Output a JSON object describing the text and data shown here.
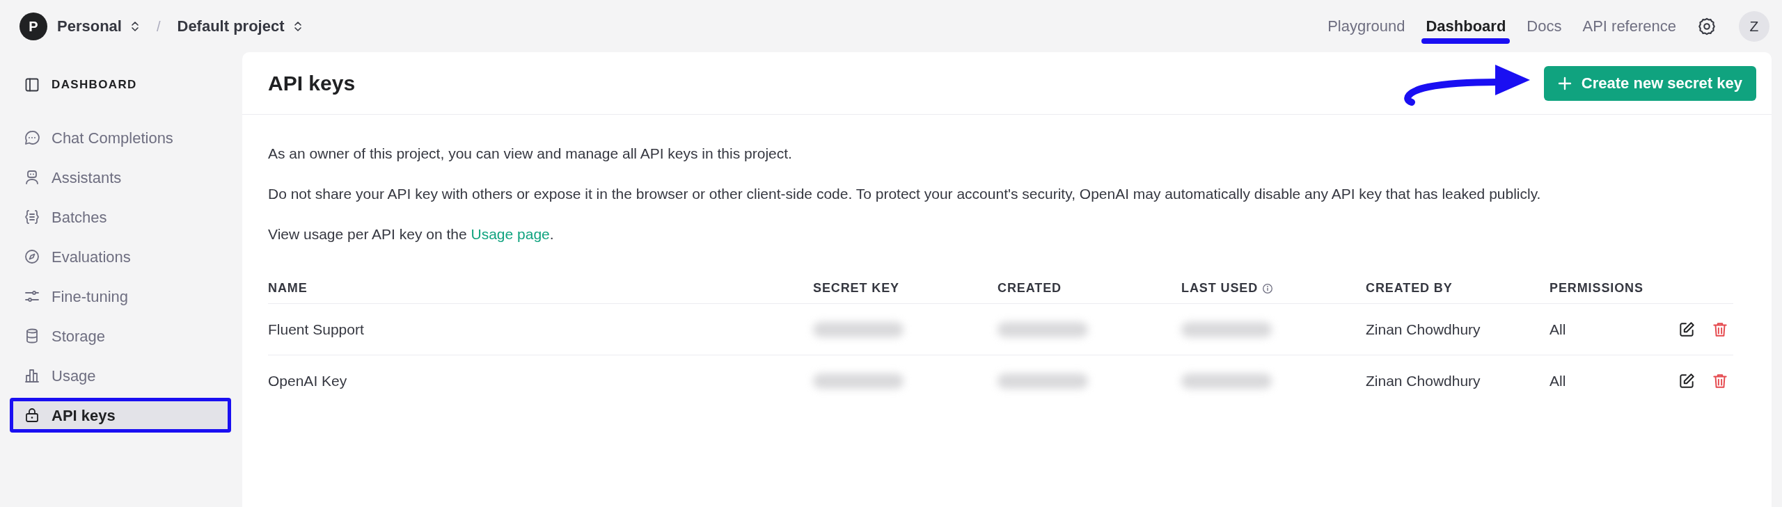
{
  "topbar": {
    "org": {
      "initial": "P",
      "name": "Personal"
    },
    "separator": "/",
    "project": "Default project",
    "nav": [
      {
        "label": "Playground",
        "selected": false,
        "highlighted": false
      },
      {
        "label": "Dashboard",
        "selected": true,
        "highlighted": true
      },
      {
        "label": "Docs",
        "selected": false,
        "highlighted": false
      },
      {
        "label": "API reference",
        "selected": false,
        "highlighted": false
      }
    ],
    "user_initial": "Z"
  },
  "sidebar": {
    "heading": "DASHBOARD",
    "items": [
      {
        "label": "Chat Completions",
        "kind": "chat",
        "selected": false,
        "highlighted": false
      },
      {
        "label": "Assistants",
        "kind": "bot",
        "selected": false,
        "highlighted": false
      },
      {
        "label": "Batches",
        "kind": "braces",
        "selected": false,
        "highlighted": false
      },
      {
        "label": "Evaluations",
        "kind": "compass",
        "selected": false,
        "highlighted": false
      },
      {
        "label": "Fine-tuning",
        "kind": "sliders",
        "selected": false,
        "highlighted": false
      },
      {
        "label": "Storage",
        "kind": "database",
        "selected": false,
        "highlighted": false
      },
      {
        "label": "Usage",
        "kind": "chart",
        "selected": false,
        "highlighted": false
      },
      {
        "label": "API keys",
        "kind": "lock",
        "selected": true,
        "highlighted": true
      }
    ]
  },
  "main": {
    "title": "API keys",
    "create_button": {
      "label": "Create new secret key",
      "callout_arrow": true
    },
    "paragraphs": [
      "As an owner of this project, you can view and manage all API keys in this project.",
      "Do not share your API key with others or expose it in the browser or other client-side code. To protect your account's security, OpenAI may automatically disable any API key that has leaked publicly."
    ],
    "usage_line": {
      "text": "View usage per API key on the",
      "link": "Usage page",
      "end": "."
    },
    "table": {
      "columns": [
        {
          "label": "NAME"
        },
        {
          "label": "SECRET KEY"
        },
        {
          "label": "CREATED"
        },
        {
          "label": "LAST USED",
          "info": true
        },
        {
          "label": "CREATED BY"
        },
        {
          "label": "PERMISSIONS"
        }
      ],
      "rows": [
        {
          "name": "Fluent Support",
          "secret_key_redacted": true,
          "created_redacted": true,
          "last_used_redacted": true,
          "created_by": "Zinan Chowdhury",
          "permissions": "All"
        },
        {
          "name": "OpenAI Key",
          "secret_key_redacted": true,
          "created_redacted": true,
          "last_used_redacted": true,
          "created_by": "Zinan Chowdhury",
          "permissions": "All"
        }
      ]
    }
  }
}
